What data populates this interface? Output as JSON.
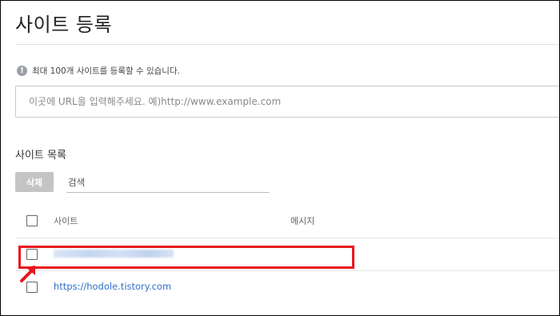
{
  "page": {
    "title": "사이트 등록",
    "notice": "최대 100개 사이트를 등록할 수 있습니다."
  },
  "url_input": {
    "value": "",
    "placeholder": "이곳에 URL을 입력해주세요. 예)http://www.example.com"
  },
  "site_list": {
    "heading": "사이트 목록",
    "delete_label": "삭제",
    "search_placeholder": "검색",
    "columns": {
      "site": "사이트",
      "message": "메시지"
    },
    "rows": [
      {
        "site": "",
        "message": "",
        "redacted": true,
        "highlighted": true
      },
      {
        "site": "https://hodole.tistory.com",
        "message": ""
      }
    ]
  },
  "colors": {
    "highlight": "#e8151c",
    "link": "#2f6fc9",
    "button_disabled": "#c4c4c4"
  },
  "icons": {
    "notice": "info-icon",
    "annotation": "red-arrow-icon"
  }
}
